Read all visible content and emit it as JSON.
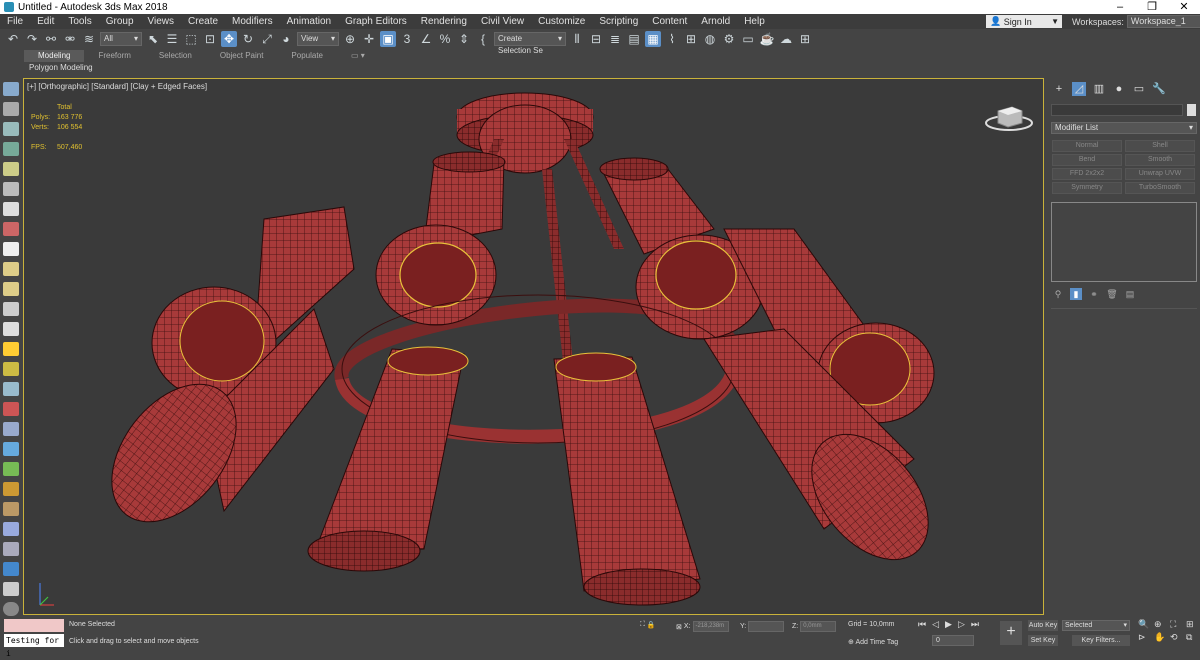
{
  "window": {
    "title": "Untitled - Autodesk 3ds Max 2018",
    "controls": [
      "–",
      "❐",
      "✕"
    ]
  },
  "menu": [
    "File",
    "Edit",
    "Tools",
    "Group",
    "Views",
    "Create",
    "Modifiers",
    "Animation",
    "Graph Editors",
    "Rendering",
    "Civil View",
    "Customize",
    "Scripting",
    "Content",
    "Arnold",
    "Help"
  ],
  "account": {
    "signin": "Sign In",
    "workspaces_label": "Workspaces:",
    "workspace": "Workspace_1"
  },
  "toolbar": {
    "filter": "All",
    "view": "View",
    "selection_set": "Create Selection Se",
    "icons_left": [
      "undo-icon",
      "redo-icon",
      "link-icon",
      "unlink-icon",
      "bind-space-warp-icon"
    ],
    "icons_mid": [
      "select-object-icon",
      "select-by-name-icon",
      "rectangle-select-icon",
      "window-crossing-icon",
      "move-icon",
      "rotate-icon",
      "scale-icon",
      "place-icon"
    ],
    "icons_right": [
      "mirror-icon",
      "align-icon",
      "layer-explorer-icon",
      "scene-explorer-icon",
      "ribbon-toggle-icon",
      "curve-editor-icon",
      "schematic-view-icon",
      "material-editor-icon",
      "render-setup-icon",
      "rendered-frame-icon",
      "render-icon",
      "render-cloud-icon",
      "a360-icon"
    ]
  },
  "ribbon": {
    "tabs": [
      "Modeling",
      "Freeform",
      "Selection",
      "Object Paint",
      "Populate"
    ],
    "active_tab": "Modeling",
    "panel": "Polygon Modeling"
  },
  "viewport": {
    "label": "[+] [Orthographic] [Standard] [Clay + Edged Faces]",
    "stats": {
      "header": "Total",
      "polys_label": "Polys:",
      "polys": "163 776",
      "verts_label": "Verts:",
      "verts": "106 554",
      "fps_label": "FPS:",
      "fps": "507,460"
    },
    "colors": {
      "model": "#a83a3a",
      "wire": "#3a0e0e",
      "highlight": "#e8c23a",
      "border": "#c9b23a"
    }
  },
  "command_panel": {
    "modifier_list": "Modifier List",
    "modifiers": [
      "Normal",
      "Shell",
      "Bend",
      "Smooth",
      "FFD 2x2x2",
      "Unwrap UVW",
      "Symmetry",
      "TurboSmooth"
    ],
    "tabs": [
      "create-icon",
      "modify-icon",
      "hierarchy-icon",
      "motion-icon",
      "display-icon",
      "utilities-icon"
    ]
  },
  "status": {
    "maxscript_output": "Testing for i",
    "selection": "None Selected",
    "prompt": "Click and drag to select and move objects",
    "x_label": "X:",
    "x_value": "-218,238m",
    "y_label": "Y:",
    "y_value": "",
    "z_label": "Z:",
    "z_value": "0,0mm",
    "grid": "Grid = 10,0mm",
    "add_time_tag": "Add Time Tag",
    "frame": "0",
    "auto_key": "Auto Key",
    "set_key": "Set Key",
    "selected": "Selected",
    "key_filters": "Key Filters..."
  }
}
